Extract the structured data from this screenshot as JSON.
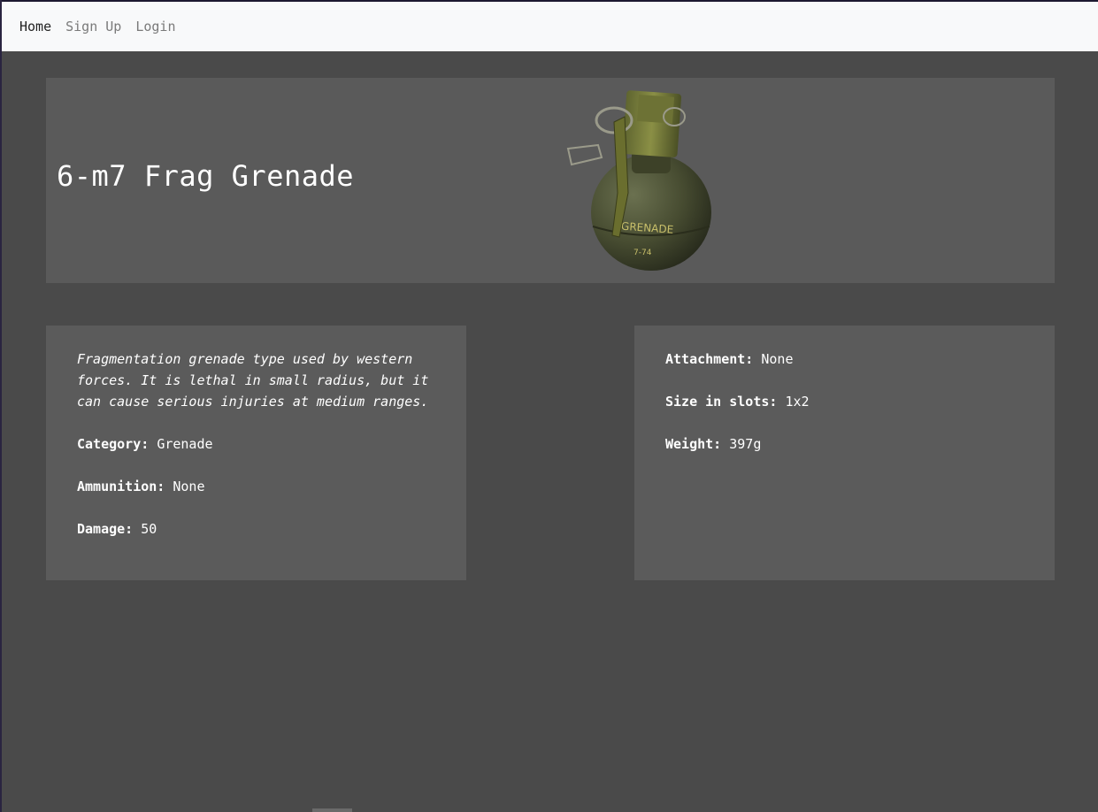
{
  "nav": {
    "links": [
      {
        "label": "Home"
      },
      {
        "label": "Sign Up"
      },
      {
        "label": "Login"
      }
    ]
  },
  "item": {
    "title": "6-m7 Frag Grenade",
    "image_icon": "grenade-image",
    "image_text": "GRENADE",
    "image_subtext": "7-74",
    "description": "Fragmentation grenade type used by western forces. It is lethal in small radius, but it can cause serious injuries at medium ranges.",
    "left_stats": [
      {
        "label": "Category:",
        "value": "Grenade"
      },
      {
        "label": "Ammunition:",
        "value": "None"
      },
      {
        "label": "Damage:",
        "value": "50"
      }
    ],
    "right_stats": [
      {
        "label": "Attachment:",
        "value": "None"
      },
      {
        "label": "Size in slots:",
        "value": "1x2"
      },
      {
        "label": "Weight:",
        "value": "397g"
      }
    ]
  },
  "colors": {
    "page_bg": "#4a4a4a",
    "panel_bg": "#5a5a5a",
    "navbar_bg": "#f8f9fa",
    "grenade_body": "#4b5234"
  }
}
